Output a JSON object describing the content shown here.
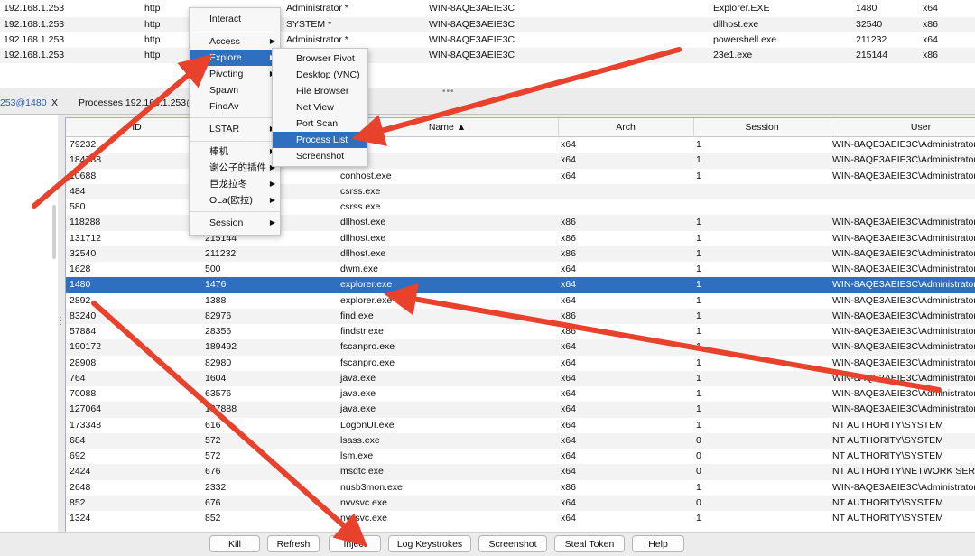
{
  "sessions": [
    {
      "external": "192.168.1.253",
      "listener": "http",
      "user": "Administrator *",
      "computer": "WIN-8AQE3AEIE3C",
      "process": "Explorer.EXE",
      "pid": "1480",
      "arch": "x64"
    },
    {
      "external": "192.168.1.253",
      "listener": "http",
      "user": "SYSTEM *",
      "computer": "WIN-8AQE3AEIE3C",
      "process": "dllhost.exe",
      "pid": "32540",
      "arch": "x86"
    },
    {
      "external": "192.168.1.253",
      "listener": "http",
      "user": "Administrator *",
      "computer": "WIN-8AQE3AEIE3C",
      "process": "powershell.exe",
      "pid": "211232",
      "arch": "x64"
    },
    {
      "external": "192.168.1.253",
      "listener": "http",
      "user": "",
      "computer": "WIN-8AQE3AEIE3C",
      "process": "23e1.exe",
      "pid": "215144",
      "arch": "x86"
    }
  ],
  "tabs": {
    "host": "253@1480",
    "close": "X",
    "processes": "Processes 192.168.1.253@"
  },
  "splitter_grip": "•••",
  "process_table": {
    "columns": [
      "PID",
      "",
      "Name ▲",
      "Arch",
      "Session",
      "User"
    ],
    "rows": [
      [
        "79232",
        "",
        "",
        "x64",
        "1",
        "WIN-8AQE3AEIE3C\\Administrator"
      ],
      [
        "184788",
        "",
        "",
        "x64",
        "1",
        "WIN-8AQE3AEIE3C\\Administrator"
      ],
      [
        "10688",
        "",
        "conhost.exe",
        "x64",
        "1",
        "WIN-8AQE3AEIE3C\\Administrator"
      ],
      [
        "484",
        "",
        "csrss.exe",
        "",
        "",
        ""
      ],
      [
        "580",
        "",
        "csrss.exe",
        "",
        "",
        ""
      ],
      [
        "118288",
        "",
        "dllhost.exe",
        "x86",
        "1",
        "WIN-8AQE3AEIE3C\\Administrator"
      ],
      [
        "131712",
        "215144",
        "dllhost.exe",
        "x86",
        "1",
        "WIN-8AQE3AEIE3C\\Administrator"
      ],
      [
        "32540",
        "211232",
        "dllhost.exe",
        "x86",
        "1",
        "WIN-8AQE3AEIE3C\\Administrator"
      ],
      [
        "1628",
        "500",
        "dwm.exe",
        "x64",
        "1",
        "WIN-8AQE3AEIE3C\\Administrator"
      ],
      [
        "1480",
        "1476",
        "explorer.exe",
        "x64",
        "1",
        "WIN-8AQE3AEIE3C\\Administrator"
      ],
      [
        "2892",
        "1388",
        "explorer.exe",
        "x64",
        "1",
        "WIN-8AQE3AEIE3C\\Administrator"
      ],
      [
        "83240",
        "82976",
        "find.exe",
        "x86",
        "1",
        "WIN-8AQE3AEIE3C\\Administrator"
      ],
      [
        "57884",
        "28356",
        "findstr.exe",
        "x86",
        "1",
        "WIN-8AQE3AEIE3C\\Administrator"
      ],
      [
        "190172",
        "189492",
        "fscanpro.exe",
        "x64",
        "1",
        "WIN-8AQE3AEIE3C\\Administrator"
      ],
      [
        "28908",
        "82980",
        "fscanpro.exe",
        "x64",
        "1",
        "WIN-8AQE3AEIE3C\\Administrator"
      ],
      [
        "764",
        "1604",
        "java.exe",
        "x64",
        "1",
        "WIN-8AQE3AEIE3C\\Administrator"
      ],
      [
        "70088",
        "63576",
        "java.exe",
        "x64",
        "1",
        "WIN-8AQE3AEIE3C\\Administrator"
      ],
      [
        "127064",
        "107888",
        "java.exe",
        "x64",
        "1",
        "WIN-8AQE3AEIE3C\\Administrator"
      ],
      [
        "173348",
        "616",
        "LogonUI.exe",
        "x64",
        "1",
        "NT AUTHORITY\\SYSTEM"
      ],
      [
        "684",
        "572",
        "lsass.exe",
        "x64",
        "0",
        "NT AUTHORITY\\SYSTEM"
      ],
      [
        "692",
        "572",
        "lsm.exe",
        "x64",
        "0",
        "NT AUTHORITY\\SYSTEM"
      ],
      [
        "2424",
        "676",
        "msdtc.exe",
        "x64",
        "0",
        "NT AUTHORITY\\NETWORK SERVICE"
      ],
      [
        "2648",
        "2332",
        "nusb3mon.exe",
        "x86",
        "1",
        "WIN-8AQE3AEIE3C\\Administrator"
      ],
      [
        "852",
        "676",
        "nvvsvc.exe",
        "x64",
        "0",
        "NT AUTHORITY\\SYSTEM"
      ],
      [
        "1324",
        "852",
        "nvvsvc.exe",
        "x64",
        "1",
        "NT AUTHORITY\\SYSTEM"
      ]
    ],
    "selected_row": 9
  },
  "buttons": [
    "Kill",
    "Refresh",
    "Inject",
    "Log Keystrokes",
    "Screenshot",
    "Steal Token",
    "Help"
  ],
  "menu_main": {
    "interact": "Interact",
    "access": "Access",
    "explore": "Explore",
    "pivoting": "Pivoting",
    "spawn": "Spawn",
    "findav": "FindAv",
    "lstar": "LSTAR",
    "bangji": "棒机",
    "xiegongzi": "谢公子的插件",
    "julong": "巨龙拉冬",
    "ola": "OLa(欧拉)",
    "session": "Session",
    "chevron": "▶"
  },
  "menu_explore": [
    "Browser Pivot",
    "Desktop (VNC)",
    "File Browser",
    "Net View",
    "Port Scan",
    "Process List",
    "Screenshot"
  ],
  "colors": {
    "highlight": "#2f6fbf",
    "annotation_arrow": "#e8422c"
  }
}
